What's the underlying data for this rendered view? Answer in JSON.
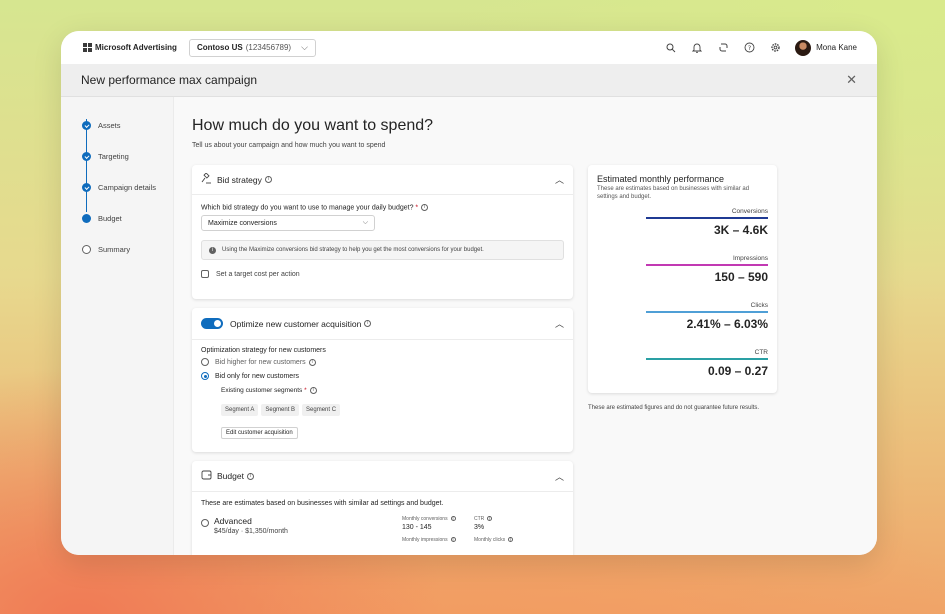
{
  "app": {
    "brand": "Microsoft Advertising",
    "account_name": "Contoso US",
    "account_id": "(123456789)",
    "user_name": "Mona Kane"
  },
  "header": {
    "title": "New performance max campaign"
  },
  "steps": [
    {
      "label": "Assets",
      "state": "done"
    },
    {
      "label": "Targeting",
      "state": "done"
    },
    {
      "label": "Campaign details",
      "state": "done"
    },
    {
      "label": "Budget",
      "state": "current"
    },
    {
      "label": "Summary",
      "state": "todo"
    }
  ],
  "main": {
    "title": "How much do you want to spend?",
    "subtitle": "Tell us about your campaign and how much you want to spend"
  },
  "bid": {
    "title": "Bid strategy",
    "question": "Which bid strategy do you want to use to manage your daily budget?",
    "required_mark": "*",
    "selected": "Maximize conversions",
    "note": "Using the Maximize conversions bid strategy to help you get the most conversions for your budget.",
    "checkbox_label": "Set a target cost per action"
  },
  "optimize": {
    "title": "Optimize new customer acquisition",
    "strategy_label": "Optimization strategy for new customers",
    "option1": "Bid higher for new customers",
    "option2": "Bid only for new customers",
    "segments_label": "Existing customer segments",
    "required_mark": "*",
    "segments": [
      "Segment A",
      "Segment B",
      "Segment C"
    ],
    "edit_button": "Edit customer acquisition"
  },
  "budget": {
    "title": "Budget",
    "description": "These are estimates based on businesses with similar ad settings and budget.",
    "option_name": "Advanced",
    "option_price": "$45/day · $1,350/month",
    "conv_label": "Monthly conversions",
    "conv_value": "130 - 145",
    "ctr_label": "CTR",
    "ctr_value": "3%",
    "impr_label": "Monthly impressions",
    "clicks_label": "Monthly clicks"
  },
  "performance": {
    "title": "Estimated monthly performance",
    "description": "These are estimates based on businesses with similar ad settings and budget.",
    "metrics": [
      {
        "label": "Conversions",
        "value": "3K – 4.6K",
        "color": "#1f3a93"
      },
      {
        "label": "Impressions",
        "value": "150 – 590",
        "color": "#c239b3"
      },
      {
        "label": "Clicks",
        "value": "2.41% – 6.03%",
        "color": "#4f9fd6"
      },
      {
        "label": "CTR",
        "value": "0.09 – 0.27",
        "color": "#2aa0a4"
      }
    ],
    "disclaimer": "These are estimated figures and do not guarantee future results."
  },
  "colors": {
    "accent": "#0f6cbd"
  }
}
